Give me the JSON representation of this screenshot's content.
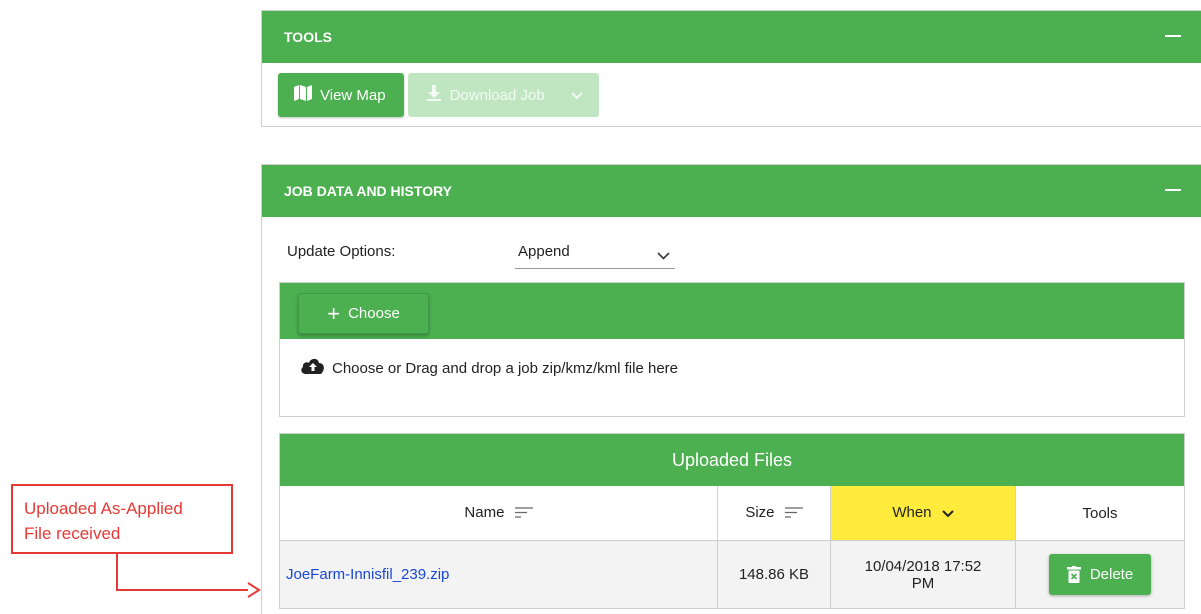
{
  "tools_panel": {
    "title": "TOOLS",
    "view_map_label": "View Map",
    "download_job_label": "Download Job"
  },
  "job_panel": {
    "title": "JOB DATA AND HISTORY",
    "update_options_label": "Update Options:",
    "update_options_value": "Append",
    "choose_label": "Choose",
    "drop_text": "Choose or Drag and drop a job zip/kmz/kml file here"
  },
  "uploaded_files": {
    "title": "Uploaded Files",
    "columns": [
      "Name",
      "Size",
      "When",
      "Tools"
    ],
    "rows": [
      {
        "name": "JoeFarm-Innisfil_239.zip",
        "size": "148.86 KB",
        "when_line1": "10/04/2018 17:52",
        "when_line2": "PM",
        "action": "Delete"
      }
    ]
  },
  "annotation": {
    "line1": "Uploaded As-Applied",
    "line2": "File received",
    "color": "#e53935"
  },
  "colors": {
    "accent": "#4caf50",
    "sort_highlight": "#ffeb3b",
    "link": "#1a47d8"
  }
}
